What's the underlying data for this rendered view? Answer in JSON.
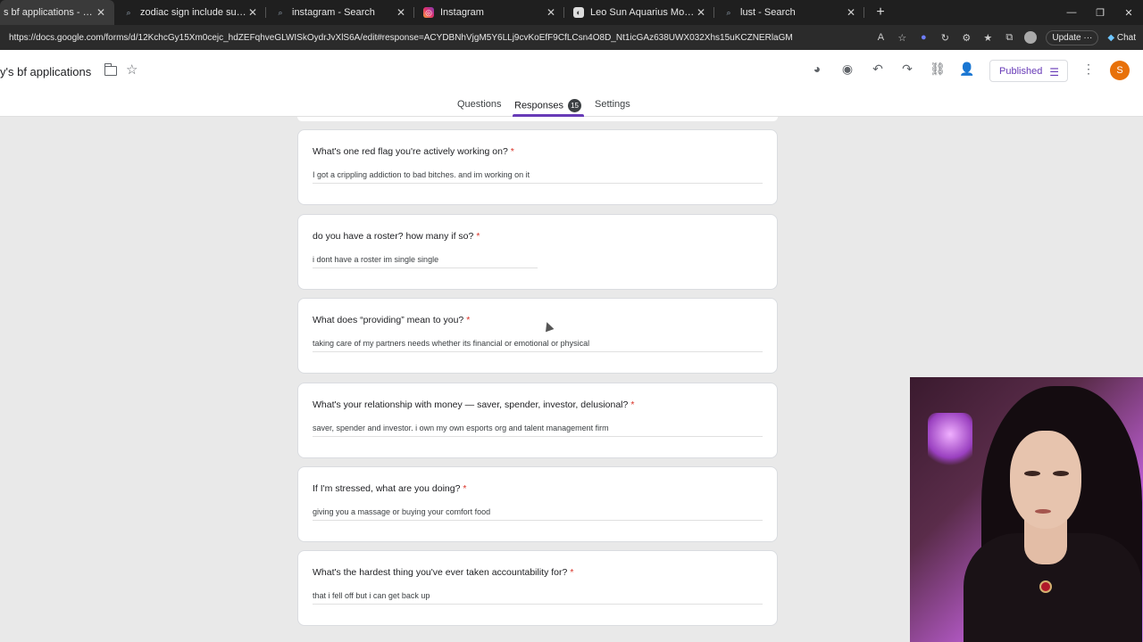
{
  "browser": {
    "tabs": [
      {
        "title": "s bf applications - Google Forms",
        "icon": "google-forms-icon",
        "active": true
      },
      {
        "title": "zodiac sign include sun, moon, AND",
        "icon": "search-icon",
        "active": false
      },
      {
        "title": "instagram - Search",
        "icon": "search-icon",
        "active": false
      },
      {
        "title": "Instagram",
        "icon": "instagram-icon",
        "active": false
      },
      {
        "title": "Leo Sun Aquarius Moon",
        "icon": "website-icon",
        "active": false
      },
      {
        "title": "lust - Search",
        "icon": "search-icon",
        "active": false
      }
    ],
    "new_tab": "+",
    "url": "https://docs.google.com/forms/d/12KchcGy15Xm0cejc_hdZEFqhveGLWISkOydrJvXlS6A/edit#response=ACYDBNhVjgM5Y6LLj9cvKoEfF9CfLCsn4O8D_Nt1icGAz638UWX032Xhs15uKCZNERlaGM",
    "update_label": "Update",
    "chat_label": "Chat"
  },
  "form": {
    "title": "y's bf applications",
    "published_label": "Published",
    "avatar_initial": "S",
    "tabs": {
      "questions": "Questions",
      "responses": "Responses",
      "responses_count": "15",
      "settings": "Settings"
    }
  },
  "responses": [
    {
      "question": "What's one red flag you're actively working on?",
      "required": "*",
      "answer": "I got a crippling addiction to bad bitches. and im working on it"
    },
    {
      "question": "do you have a roster? how many if so?",
      "required": "*",
      "answer": "i dont have a roster im single single"
    },
    {
      "question": "What does “providing” mean to you?",
      "required": "*",
      "answer": "taking care of my partners needs whether its financial or emotional or physical"
    },
    {
      "question": "What's your relationship with money — saver, spender, investor, delusional?",
      "required": "*",
      "answer": "saver, spender and investor. i own my own esports org and talent management firm"
    },
    {
      "question": "If I'm stressed, what are you doing?",
      "required": "*",
      "answer": "giving you a massage or buying your comfort food"
    },
    {
      "question": "What's the hardest thing you've ever taken accountability for?",
      "required": "*",
      "answer": "that i fell off but i can get back up"
    }
  ],
  "colors": {
    "accent": "#673ab7",
    "required": "#d93025",
    "avatar": "#e8710a"
  }
}
